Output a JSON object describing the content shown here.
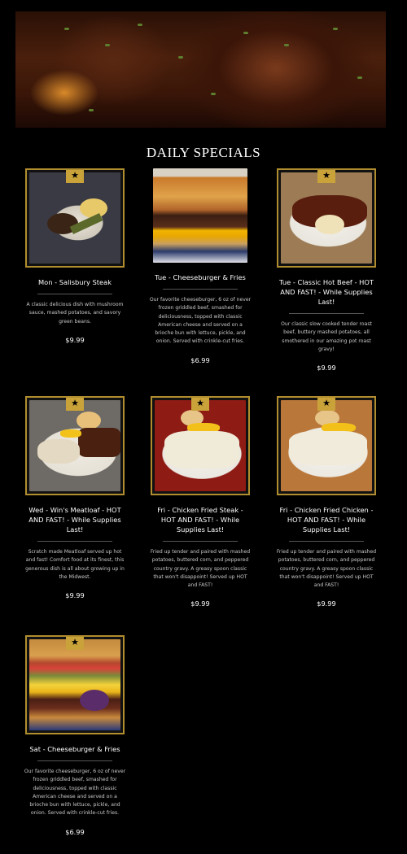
{
  "section_title": "DAILY SPECIALS",
  "badge_icon": "★",
  "accent_color": "#b08d2e",
  "specials": [
    {
      "name": "Mon - Salisbury Steak",
      "description": "A classic delicious dish with mushroom sauce, mashed potatoes, and savory green beans.",
      "price": "$9.99",
      "photo": "salisbury-steak-photo"
    },
    {
      "name": "Tue - Cheeseburger & Fries",
      "description": "Our favorite cheeseburger, 6 oz of never frozen griddled beef, smashed for deliciousness, topped with classic American cheese and served on a brioche bun with lettuce, pickle, and onion. Served with crinkle-cut fries.",
      "price": "$6.99",
      "photo": "cheeseburger-photo"
    },
    {
      "name": "Tue - Classic Hot Beef - HOT AND FAST! - While Supplies Last!",
      "description": "Our classic slow cooked tender roast beef, buttery mashed potatoes, all smothered in our amazing pot roast gravy!",
      "price": "$9.99",
      "photo": "hot-beef-photo"
    },
    {
      "name": "Wed - Win's Meatloaf - HOT AND FAST! - While Supplies Last!",
      "description": "Scratch made Meatloaf served up hot and fast! Comfort food at its finest, this generous dish is all about growing up in the Midwest.",
      "price": "$9.99",
      "photo": "meatloaf-photo"
    },
    {
      "name": "Fri - Chicken Fried Steak - HOT AND FAST! - While Supplies Last!",
      "description": "Fried up tender and paired with mashed potatoes, buttered corn, and peppered country gravy. A greasy spoon classic that won't disappoint! Served up HOT and FAST!",
      "price": "$9.99",
      "photo": "chicken-fried-steak-photo"
    },
    {
      "name": "Fri - Chicken Fried Chicken - HOT AND FAST! - While Supplies Last!",
      "description": "Fried up tender and paired with mashed potatoes, buttered corn, and peppered country gravy. A greasy spoon classic that won't disappoint! Served up HOT and FAST!",
      "price": "$9.99",
      "photo": "chicken-fried-chicken-photo"
    },
    {
      "name": "Sat - Cheeseburger & Fries",
      "description": "Our favorite cheeseburger, 6 oz of never frozen griddled beef, smashed for deliciousness, topped with classic American cheese and served on a brioche bun with lettuce, pickle, and onion. Served with crinkle-cut fries.",
      "price": "$6.99",
      "photo": "cheeseburger-photo"
    }
  ]
}
